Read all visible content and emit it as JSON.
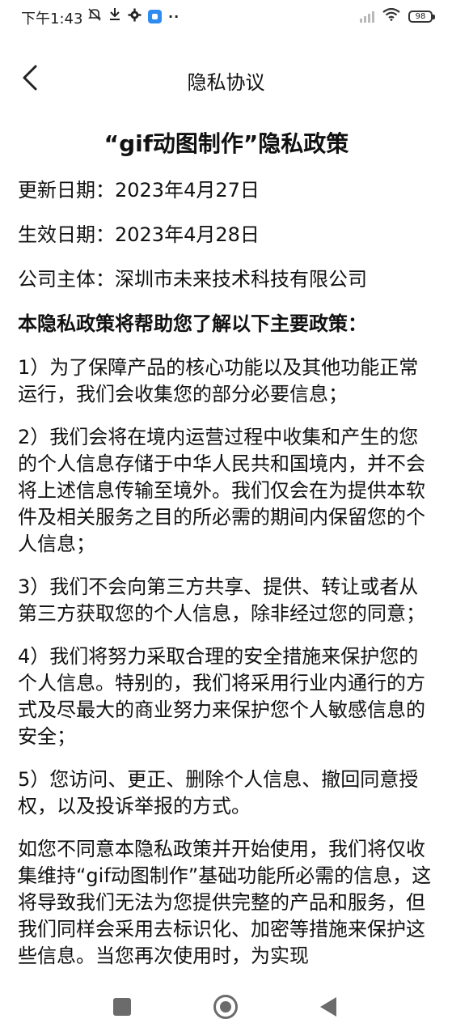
{
  "status_bar": {
    "time": "下午1:43",
    "battery": "98",
    "more_indicator": "··",
    "icons": [
      "mute-icon",
      "download-icon",
      "gear-icon",
      "app-notification-icon",
      "signal-icon",
      "wifi-icon",
      "battery-icon"
    ]
  },
  "header": {
    "title": "隐私协议",
    "back_icon": "chevron-left-icon"
  },
  "document": {
    "title": "“gif动图制作”隐私政策",
    "update_date": "更新日期：2023年4月27日",
    "effective_date": "生效日期：2023年4月28日",
    "company": "公司主体：深圳市未来技术科技有限公司",
    "summary_heading": "本隐私政策将帮助您了解以下主要政策：",
    "paragraphs": [
      "1）为了保障产品的核心功能以及其他功能正常运行，我们会收集您的部分必要信息；",
      "2）我们会将在境内运营过程中收集和产生的您的个人信息存储于中华人民共和国境内，并不会将上述信息传输至境外。我们仅会在为提供本软件及相关服务之目的所必需的期间内保留您的个人信息；",
      "3）我们不会向第三方共享、提供、转让或者从第三方获取您的个人信息，除非经过您的同意；",
      "4）我们将努力采取合理的安全措施来保护您的个人信息。特别的，我们将采用行业内通行的方式及尽最大的商业努力来保护您个人敏感信息的安全；",
      "5）您访问、更正、删除个人信息、撤回同意授权，以及投诉举报的方式。",
      "如您不同意本隐私政策并开始使用，我们将仅收集维持“gif动图制作”基础功能所必需的信息，这将导致我们无法为您提供完整的产品和服务，但我们同样会采用去标识化、加密等措施来保护这些信息。当您再次使用时，为实现"
    ]
  },
  "system_nav": {
    "icons": [
      "recents-square-icon",
      "home-circle-icon",
      "back-triangle-icon"
    ]
  }
}
